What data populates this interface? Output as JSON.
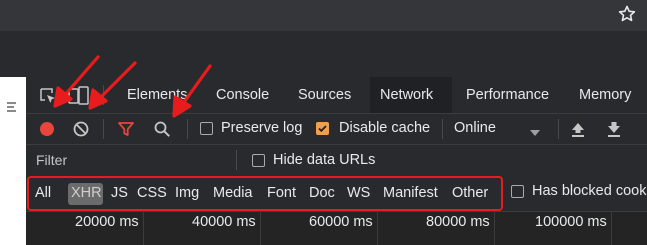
{
  "devtools": {
    "tabs": [
      {
        "label": "Elements"
      },
      {
        "label": "Console"
      },
      {
        "label": "Sources"
      },
      {
        "label": "Network"
      },
      {
        "label": "Performance"
      },
      {
        "label": "Memory"
      }
    ],
    "active_tab": "Network",
    "toolbar": {
      "preserve_log_label": "Preserve log",
      "preserve_log_checked": false,
      "disable_cache_label": "Disable cache",
      "disable_cache_checked": true,
      "throttle_value": "Online"
    },
    "filter": {
      "placeholder": "Filter",
      "hide_data_urls_label": "Hide data URLs",
      "hide_data_urls_checked": false
    },
    "resource_types": [
      {
        "label": "All"
      },
      {
        "label": "XHR"
      },
      {
        "label": "JS"
      },
      {
        "label": "CSS"
      },
      {
        "label": "Img"
      },
      {
        "label": "Media"
      },
      {
        "label": "Font"
      },
      {
        "label": "Doc"
      },
      {
        "label": "WS"
      },
      {
        "label": "Manifest"
      },
      {
        "label": "Other"
      }
    ],
    "selected_type": "XHR",
    "blocked_cookies_label": "Has blocked cook",
    "timeline_ticks": [
      "20000 ms",
      "40000 ms",
      "60000 ms",
      "80000 ms",
      "100000 ms"
    ]
  },
  "colors": {
    "record": "#e8453c",
    "filter_funnel": "#e8453c",
    "annotation": "#e81c1c",
    "checkbox_checked": "#f0a04b"
  },
  "icons": {
    "star": "star-icon",
    "inspect": "inspect-element-icon",
    "device": "device-toolbar-icon",
    "record": "record-icon",
    "clear": "clear-icon",
    "filter": "filter-icon",
    "search": "search-icon",
    "import": "import-har-icon",
    "export": "export-har-icon",
    "dropdown": "dropdown-arrow-icon"
  }
}
